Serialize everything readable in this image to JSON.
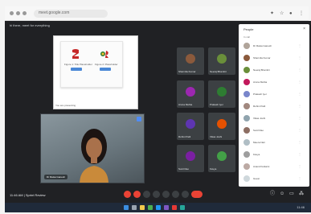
{
  "browser": {
    "url": "meet.google.com",
    "icons": [
      "extension-icon",
      "star-icon",
      "profile-icon",
      "menu-icon"
    ]
  },
  "meet": {
    "title": "hi there, meet for everything",
    "presentation": {
      "figure_left_label": "Figure 1: Title Placeholder",
      "figure_right_label": "Figure 2: Placeholder",
      "presenter": "You are presenting"
    },
    "camera": {
      "name": "Dr Raisa Ganesh"
    },
    "participants": [
      {
        "name": "Sharmila Kumar",
        "color": "#8b5a3c"
      },
      {
        "name": "Neeraj Bhambri",
        "color": "#6a8f3a"
      },
      {
        "name": "Aruna Mehta",
        "color": "#9c27b0"
      },
      {
        "name": "Prakash Iyer",
        "color": "#2e7d32"
      },
      {
        "name": "Rohini Patil",
        "color": "#5e35b1"
      },
      {
        "name": "Vikas Joshi",
        "color": "#e65100"
      },
      {
        "name": "Sunil Rao",
        "color": "#7b1fa2"
      },
      {
        "name": "Kavya",
        "color": "#43a047"
      }
    ],
    "panel": {
      "title": "People",
      "sub": "In call",
      "people": [
        {
          "name": "Dr Raisa Ganesh",
          "color": "#b0a49a"
        },
        {
          "name": "Sharmila Kumar",
          "color": "#8b5a3c"
        },
        {
          "name": "Neeraj Bhambri",
          "color": "#6a8f3a"
        },
        {
          "name": "Aruna Mehta",
          "color": "#c2185b"
        },
        {
          "name": "Prakash Iyer",
          "color": "#7986cb"
        },
        {
          "name": "Rohini Patil",
          "color": "#a1887f"
        },
        {
          "name": "Vikas Joshi",
          "color": "#90a4ae"
        },
        {
          "name": "Sunil Rao",
          "color": "#8d6e63"
        },
        {
          "name": "Meera Nair",
          "color": "#b0bec5"
        },
        {
          "name": "Kavya",
          "color": "#9e9e9e"
        },
        {
          "name": "Anand Kulkarni",
          "color": "#bcaaa4"
        },
        {
          "name": "Guest",
          "color": "#cfd8dc"
        }
      ]
    },
    "bottom": {
      "time": "11:46 AM  |  Sprint Review"
    }
  },
  "taskbar": {
    "clock": "11:46"
  }
}
